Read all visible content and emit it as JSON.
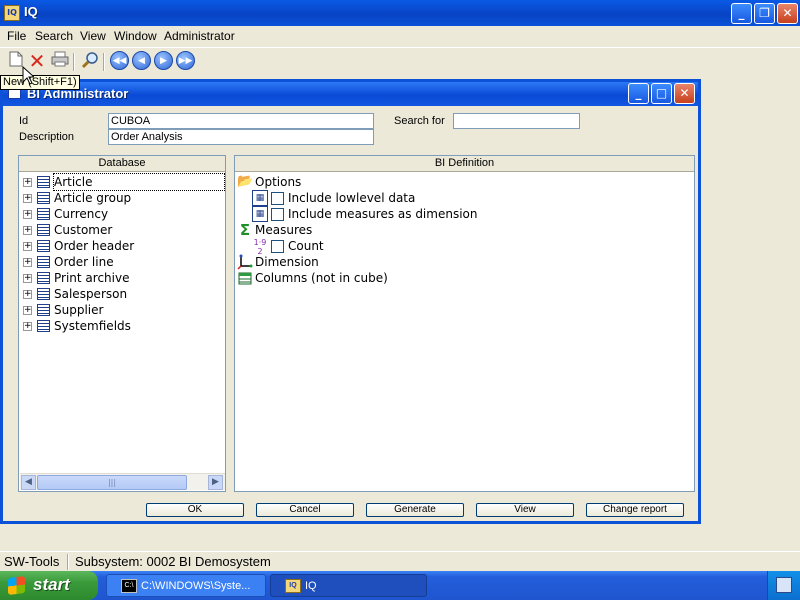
{
  "app": {
    "title": "IQ",
    "menus": [
      "File",
      "Search",
      "View",
      "Window",
      "Administrator"
    ]
  },
  "toolbar": {
    "buttons": [
      "new-document",
      "delete",
      "print",
      "search",
      "first-record",
      "previous-record",
      "next-record",
      "last-record"
    ],
    "tooltip": "New (Shift+F1)"
  },
  "dialog": {
    "title": "BI Administrator",
    "id_label": "Id",
    "id_value": "CUBOA",
    "description_label": "Description",
    "description_value": "Order Analysis",
    "search_label": "Search for",
    "search_value": "",
    "database_header": "Database",
    "database_items": [
      "Article",
      "Article group",
      "Currency",
      "Customer",
      "Order header",
      "Order line",
      "Print archive",
      "Salesperson",
      "Supplier",
      "Systemfields"
    ],
    "bi_header": "BI Definition",
    "bi_tree": {
      "options": "Options",
      "include_lowlevel": "Include lowlevel data",
      "include_measures": "Include measures as dimension",
      "measures": "Measures",
      "count": "Count",
      "dimension": "Dimension",
      "columns": "Columns (not in cube)"
    },
    "buttons": {
      "ok": "OK",
      "cancel": "Cancel",
      "generate": "Generate",
      "view": "View",
      "change_report": "Change report"
    }
  },
  "status": {
    "left": "SW-Tools",
    "right": "Subsystem: 0002 BI Demosystem"
  },
  "taskbar": {
    "start": "start",
    "tasks": [
      "C:\\WINDOWS\\Syste...",
      "IQ"
    ]
  },
  "colors": {
    "titlebar_blue": "#0a5ae6",
    "window_face": "#ece9d8",
    "start_green": "#3a9a3a"
  }
}
